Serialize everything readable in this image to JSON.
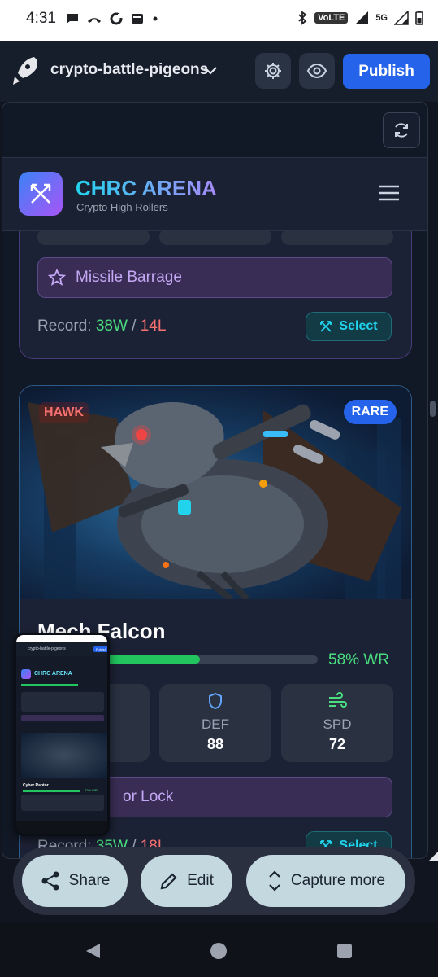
{
  "status_bar": {
    "time": "4:31",
    "network": "VoLTE",
    "signal_label": "5G"
  },
  "app_header": {
    "project_name": "crypto-battle-pigeons",
    "publish_label": "Publish"
  },
  "site": {
    "title": "CHRC ARENA",
    "subtitle": "Crypto High Rollers"
  },
  "card_top": {
    "ability": "Missile Barrage",
    "record_label": "Record:",
    "wins": "38W",
    "separator": "/",
    "losses": "14L",
    "select_label": "Select"
  },
  "card_main": {
    "type_badge": "HAWK",
    "rarity_badge": "RARE",
    "name": "Mech Falcon",
    "win_rate_percent": 58,
    "win_rate_text": "58% WR",
    "stats": [
      {
        "label": "DEF",
        "value": "88"
      },
      {
        "label": "SPD",
        "value": "72"
      }
    ],
    "ability_visible": "or Lock",
    "record_label": "Record:",
    "wins": "35W",
    "separator": "/",
    "losses": "18L",
    "select_label": "Select"
  },
  "thumbnail": {
    "project_name": "crypto-battle-pigeons",
    "publish_label": "Publish",
    "site_title": "CHRC ARENA",
    "fighter_name": "Cyber Raptor",
    "win_rate_text": "72% WR"
  },
  "actions": {
    "share": "Share",
    "edit": "Edit",
    "capture_more": "Capture more"
  },
  "colors": {
    "accent": "#2563eb",
    "win": "#4ade80",
    "loss": "#f87171",
    "ability": "#c4a8f5",
    "select": "#22d3ee"
  }
}
